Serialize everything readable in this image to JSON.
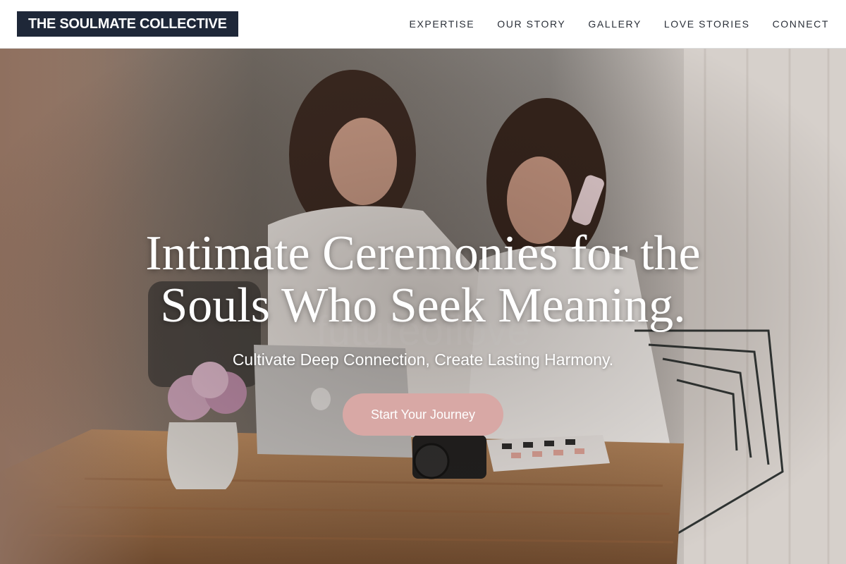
{
  "header": {
    "brand": "THE SOULMATE COLLECTIVE",
    "nav": [
      {
        "label": "EXPERTISE"
      },
      {
        "label": "OUR STORY"
      },
      {
        "label": "GALLERY"
      },
      {
        "label": "LOVE STORIES"
      },
      {
        "label": "CONNECT"
      }
    ]
  },
  "hero": {
    "title": "Intimate Ceremonies for the Souls Who Seek Meaning.",
    "subtitle": "Cultivate Deep Connection, Create Lasting Harmony.",
    "cta_label": "Start Your Journey",
    "watermark_text": "futureoflove"
  },
  "colors": {
    "brand_bg": "#1e2738",
    "cta_bg": "#d8a8a5",
    "nav_text": "#2a2f38"
  }
}
